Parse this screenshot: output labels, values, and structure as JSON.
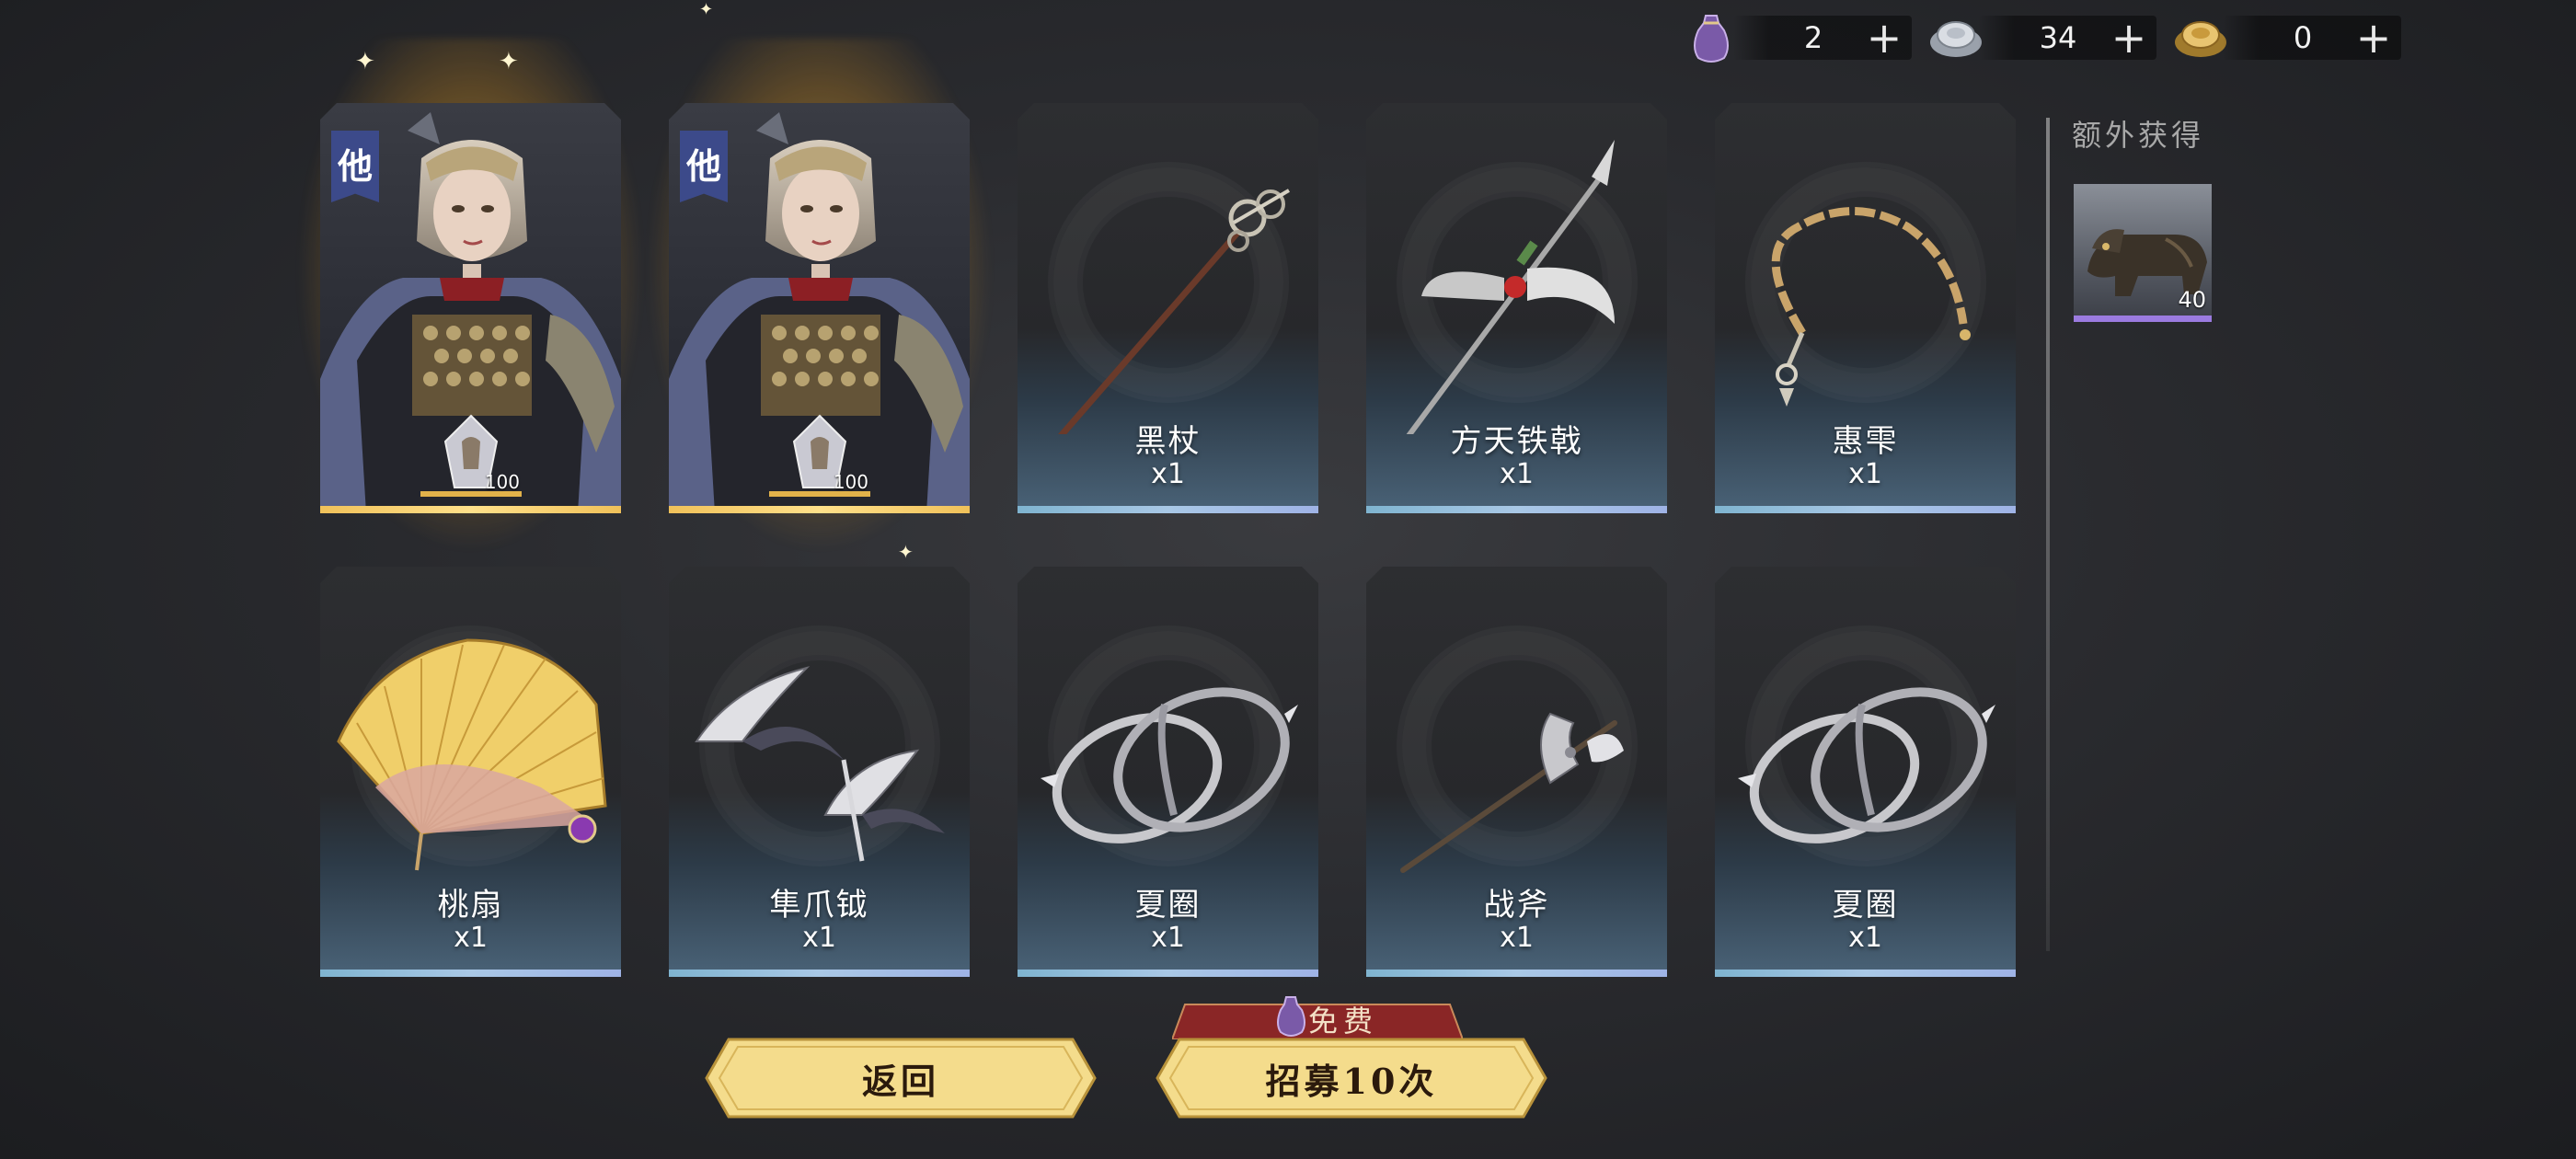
{
  "currency": [
    {
      "icon": "purple-pouch-icon",
      "value": "2"
    },
    {
      "icon": "silver-ingot-icon",
      "value": "34"
    },
    {
      "icon": "gold-ingot-icon",
      "value": "0"
    }
  ],
  "plus_symbol": "+",
  "heroes": [
    {
      "faction": "他",
      "count": "100"
    },
    {
      "faction": "他",
      "count": "100"
    }
  ],
  "row1_items": [
    {
      "name": "黑杖",
      "qty": "x1",
      "icon": "black-staff-icon"
    },
    {
      "name": "方天铁戟",
      "qty": "x1",
      "icon": "halberd-icon"
    },
    {
      "name": "惠雫",
      "qty": "x1",
      "icon": "whip-icon"
    }
  ],
  "row2_items": [
    {
      "name": "桃扇",
      "qty": "x1",
      "icon": "folding-fan-icon"
    },
    {
      "name": "隼爪钺",
      "qty": "x1",
      "icon": "claw-blades-icon"
    },
    {
      "name": "夏圈",
      "qty": "x1",
      "icon": "chakram-rings-icon"
    },
    {
      "name": "战斧",
      "qty": "x1",
      "icon": "battle-axe-icon"
    },
    {
      "name": "夏圈",
      "qty": "x1",
      "icon": "chakram-rings-icon"
    }
  ],
  "extra": {
    "title": "额外获得",
    "item": {
      "count": "40",
      "icon": "bronze-beast-statue-icon"
    }
  },
  "buttons": {
    "back": "返回",
    "recruit": "招募10次",
    "free_tag": "免费"
  },
  "colors": {
    "hero_glow": "#ffc43c",
    "item_line": "#a9c8e6",
    "extra_line": "#9b7be0",
    "button_gold": "#f4dc8c"
  }
}
